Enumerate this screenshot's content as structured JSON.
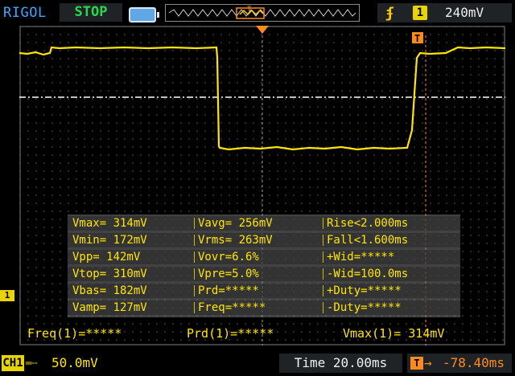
{
  "header": {
    "brand": "RIGOL",
    "run_state": "STOP",
    "run_state_color": "#28d84a",
    "trigger": {
      "edge_icon": "rising-edge-icon",
      "source_channel": "1",
      "level": "240mV"
    }
  },
  "waveform": {
    "channel": "CH1",
    "trace_color": "#ffe600",
    "trigger_position_marker": "T"
  },
  "measurements": [
    [
      "Vmax= 314mV",
      "Vavg= 256mV",
      "Rise<2.000ms"
    ],
    [
      "Vmin= 172mV",
      "Vrms= 263mV",
      "Fall<1.600ms"
    ],
    [
      "Vpp= 142mV",
      "Vovr=6.6%",
      "+Wid=*****"
    ],
    [
      "Vtop= 310mV",
      "Vpre=5.0%",
      "-Wid=100.0ms"
    ],
    [
      "Vbas= 182mV",
      "Prd=*****",
      "+Duty=*****"
    ],
    [
      "Vamp= 127mV",
      "Freq=*****",
      "-Duty=*****"
    ]
  ],
  "summary": {
    "freq": "Freq(1)=*****",
    "prd": "Prd(1)=*****",
    "vmax": "Vmax(1)= 314mV"
  },
  "footer": {
    "channel_label": "CH1",
    "coupling_icon": "dc-coupling-icon",
    "channel_scale": "50.0mV",
    "timebase": "Time 20.00ms",
    "trigger_offset_icon": "T",
    "trigger_offset_arrow": "→",
    "trigger_offset": "-78.40ms"
  },
  "channel_marker": "1"
}
